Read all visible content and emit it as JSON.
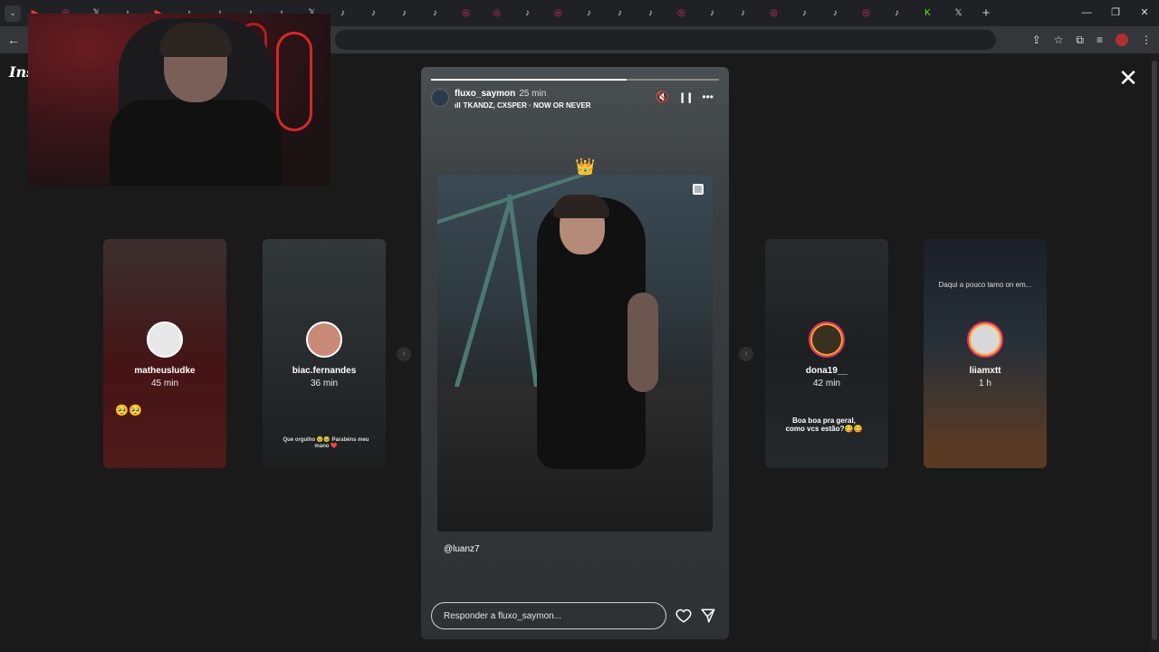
{
  "browser": {
    "tabs": [
      {
        "icon": "youtube-icon",
        "color": "#e53935"
      },
      {
        "icon": "instagram-icon",
        "color": "#d62976"
      },
      {
        "icon": "x-icon",
        "color": "#dddddd"
      },
      {
        "icon": "tiktok-icon",
        "color": "#dddddd"
      },
      {
        "icon": "youtube-icon",
        "color": "#e53935"
      },
      {
        "icon": "tiktok-icon",
        "color": "#dddddd"
      },
      {
        "icon": "tiktok-icon",
        "color": "#dddddd"
      },
      {
        "icon": "tiktok-icon",
        "color": "#dddddd"
      },
      {
        "icon": "tiktok-icon",
        "color": "#dddddd"
      },
      {
        "icon": "x-icon",
        "color": "#dddddd"
      },
      {
        "icon": "tiktok-icon",
        "color": "#dddddd"
      },
      {
        "icon": "tiktok-icon",
        "color": "#dddddd"
      },
      {
        "icon": "tiktok-icon",
        "color": "#dddddd"
      },
      {
        "icon": "tiktok-icon",
        "color": "#dddddd"
      },
      {
        "icon": "instagram-icon",
        "color": "#d62976"
      },
      {
        "icon": "instagram-icon",
        "color": "#d62976"
      },
      {
        "icon": "tiktok-icon",
        "color": "#dddddd"
      },
      {
        "icon": "instagram-icon",
        "color": "#d62976"
      },
      {
        "icon": "tiktok-icon",
        "color": "#dddddd"
      },
      {
        "icon": "tiktok-icon",
        "color": "#dddddd"
      },
      {
        "icon": "tiktok-icon",
        "color": "#dddddd"
      },
      {
        "icon": "instagram-icon",
        "color": "#d62976"
      },
      {
        "icon": "tiktok-icon",
        "color": "#dddddd"
      },
      {
        "icon": "tiktok-icon",
        "color": "#dddddd"
      },
      {
        "icon": "instagram-icon",
        "color": "#d62976"
      },
      {
        "icon": "tiktok-icon",
        "color": "#dddddd"
      },
      {
        "icon": "tiktok-icon",
        "color": "#dddddd"
      },
      {
        "icon": "instagram-icon",
        "color": "#d62976"
      },
      {
        "icon": "tiktok-icon",
        "color": "#dddddd"
      },
      {
        "icon": "kick-icon",
        "color": "#53fc18"
      },
      {
        "icon": "x-icon",
        "color": "#dddddd"
      }
    ],
    "new_tab": "+",
    "window_controls": {
      "minimize": "—",
      "restore": "❐",
      "close": "✕"
    }
  },
  "stories": {
    "close_icon": "close-icon",
    "left_previews": [
      {
        "username": "matheusludke",
        "time": "45 min",
        "caption": "🥺🥺",
        "color": "#6a1f22"
      },
      {
        "username": "biac.fernandes",
        "time": "36 min",
        "caption": "Que orgulho 🥹🥹 Parabéns meu mano ❤️",
        "color": "#3d4345"
      }
    ],
    "right_previews": [
      {
        "username": "dona19__",
        "time": "42 min",
        "caption": "Boa boa pra geral, como vcs estão?😋😋",
        "color": "#2c3236"
      },
      {
        "username": "liiamxtt",
        "time": "1 h",
        "caption": "Daqui a pouco tamo on em...",
        "color": "#3c4a58"
      }
    ],
    "current": {
      "username": "fluxo_saymon",
      "time": "25 min",
      "music": "TKANDZ, CXSPER · NOW OR NEVER",
      "progress": 0.68,
      "mention": "@luanz7",
      "reply_placeholder": "Responder a fluxo_saymon..."
    }
  }
}
